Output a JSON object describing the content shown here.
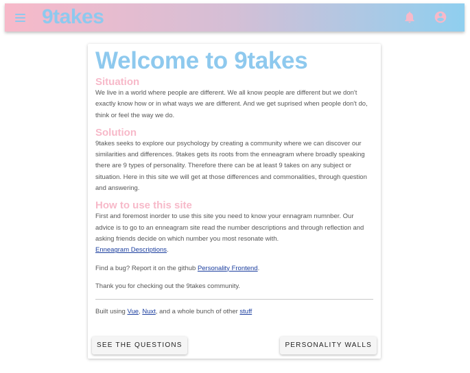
{
  "toolbar": {
    "brand": "9takes",
    "menu_icon": "menu-icon",
    "notifications_icon": "bell-icon",
    "account_icon": "account-circle-icon",
    "colors": {
      "gradient_start": "#f7b9c9",
      "gradient_end": "#8fcfef",
      "brand": "#8ec9ee"
    }
  },
  "main": {
    "title": "Welcome to 9takes",
    "situation": {
      "heading": "Situation",
      "text": "We live in a world where people are different. We all know people are different but we don't exactly know how or in what ways we are different. And we get suprised when people don't do, think or feel the way we do."
    },
    "solution": {
      "heading": "Solution",
      "text": "9takes seeks to explore our psychology by creating a community where we can discover our similarities and differences. 9takes gets its roots from the enneagram where broadly speaking there are 9 types of personality. Therefore there can be at least 9 takes on any subject or situation. Here in this site we will get at those differences and commonalities, through question and answering."
    },
    "how_to": {
      "heading": "How to use this site",
      "text": "First and foremost inorder to use this site you need to know your ennagram numnber. Our advice is to go to an enneagram site read the number descriptions and through reflection and asking friends decide on which number you most resonate with.",
      "link": "Enneagram Descriptions",
      "after_link": "."
    },
    "bug": {
      "text": "Find a bug? Report it on the github",
      "link": "Personality Frontend",
      "after_link": "."
    },
    "thanks": "Thank you for checking out the 9takes community.",
    "built": {
      "prefix": "Built using",
      "vue": "Vue",
      "sep1": ",",
      "nuxt": "Nuxt",
      "middle": ", and a whole bunch of other",
      "stuff": "stuff"
    },
    "buttons": {
      "questions": "See the questions",
      "walls": "Personality walls"
    },
    "colors": {
      "title": "#8ec9ee",
      "heading": "#f7b9c9",
      "link": "#1a3d9e"
    }
  }
}
